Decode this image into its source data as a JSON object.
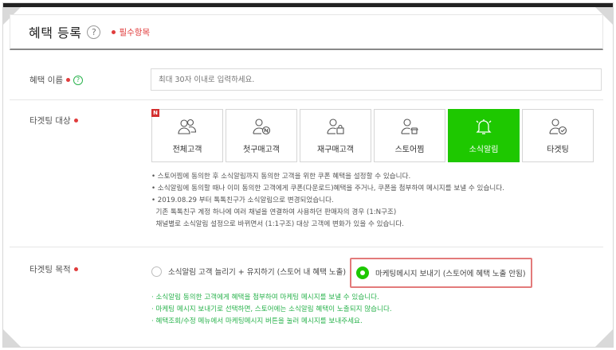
{
  "header": {
    "title": "혜택 등록",
    "help_glyph": "?",
    "required_note": "필수항목"
  },
  "name_row": {
    "label": "혜택 이름",
    "help_glyph": "?",
    "input_placeholder": "최대 30자 이내로 입력하세요."
  },
  "target_row": {
    "label": "타겟팅 대상",
    "new_badge": "N",
    "options": [
      {
        "label": "전체고객",
        "icon": "group-icon",
        "selected": false
      },
      {
        "label": "첫구매고객",
        "icon": "person-n-icon",
        "selected": false
      },
      {
        "label": "재구매고객",
        "icon": "person-bag-icon",
        "selected": false
      },
      {
        "label": "스토어찜",
        "icon": "person-store-icon",
        "selected": false
      },
      {
        "label": "소식알림",
        "icon": "bell-icon",
        "selected": true
      },
      {
        "label": "타겟팅",
        "icon": "person-check-icon",
        "selected": false
      }
    ],
    "notes": [
      "• 스토어찜에 동의한 후 소식알림까지 동의한 고객을 위한 쿠폰 혜택을 설정할 수 있습니다.",
      "• 소식알림에 동의할 때나 이미 동의한 고객에게 쿠폰(다운로드)혜택을 주거나, 쿠폰을 첨부하여 메시지를 보낼 수 있습니다.",
      "• 2019.08.29 부터 톡톡친구가 소식알림으로 변경되었습니다.",
      "  기존 톡톡친구 계정 하나에 여러 채널을 연결하여 사용하던 판매자의 경우 (1:N구조)",
      "  채널별로 소식알림 설정으로 바뀌면서 (1:1구조) 대상 고객에 변화가 있을 수 있습니다."
    ]
  },
  "purpose_row": {
    "label": "타겟팅 목적",
    "option_1": "소식알림 고객 늘리기 + 유지하기 (스토어 내 혜택 노출)",
    "option_2": "마케팅메시지 보내기 (스토어에 혜택 노출 안됨)",
    "notes": [
      "· 소식알림 동의한 고객에게 혜택을 첨부하여 마케팅 메시지를 보낼 수 있습니다.",
      "· 마케팅 메시지 보내기로 선택하면, 스토어에는 소식알림 혜택이 노출되지 않습니다.",
      "· 혜택조회/수정 메뉴에서 마케팅메시지 버튼을 눌러 메시지를 보내주세요."
    ]
  },
  "colors": {
    "accent_green": "#1ec800",
    "required_red": "#e03c3c",
    "highlight_border": "#e37a7a"
  }
}
